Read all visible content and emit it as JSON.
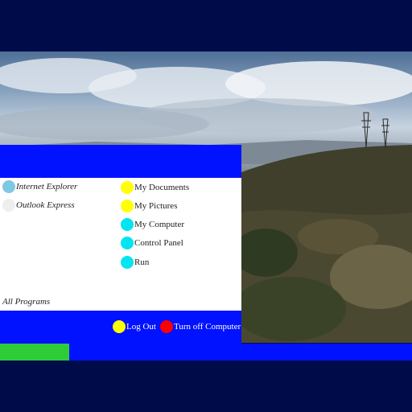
{
  "colors": {
    "desktop_bg": "#000c4a",
    "menu_blue": "#0012ff",
    "start_green": "#2fcc3a",
    "ie_icon": "#7ec8e3",
    "outlook_icon": "#eeeeee",
    "yellow": "#ffff00",
    "cyan": "#00e5f0",
    "red": "#ff0000"
  },
  "start_menu": {
    "pinned": [
      {
        "label": "Internet Explorer",
        "icon": "internet-explorer-icon",
        "color": "#7ec8e3"
      },
      {
        "label": "Outlook Express",
        "icon": "outlook-express-icon",
        "color": "#eeeeee"
      }
    ],
    "places": [
      {
        "label": "My Documents",
        "icon": "my-documents-icon",
        "color": "#ffff00"
      },
      {
        "label": "My Pictures",
        "icon": "my-pictures-icon",
        "color": "#ffff00"
      },
      {
        "label": "My Computer",
        "icon": "my-computer-icon",
        "color": "#00e5f0"
      },
      {
        "label": "Control Panel",
        "icon": "control-panel-icon",
        "color": "#00e5f0"
      },
      {
        "label": "Run",
        "icon": "run-icon",
        "color": "#00e5f0"
      }
    ],
    "all_programs": "All Programs",
    "footer": {
      "log_out": "Log Out",
      "turn_off": "Turn off Computer"
    }
  }
}
